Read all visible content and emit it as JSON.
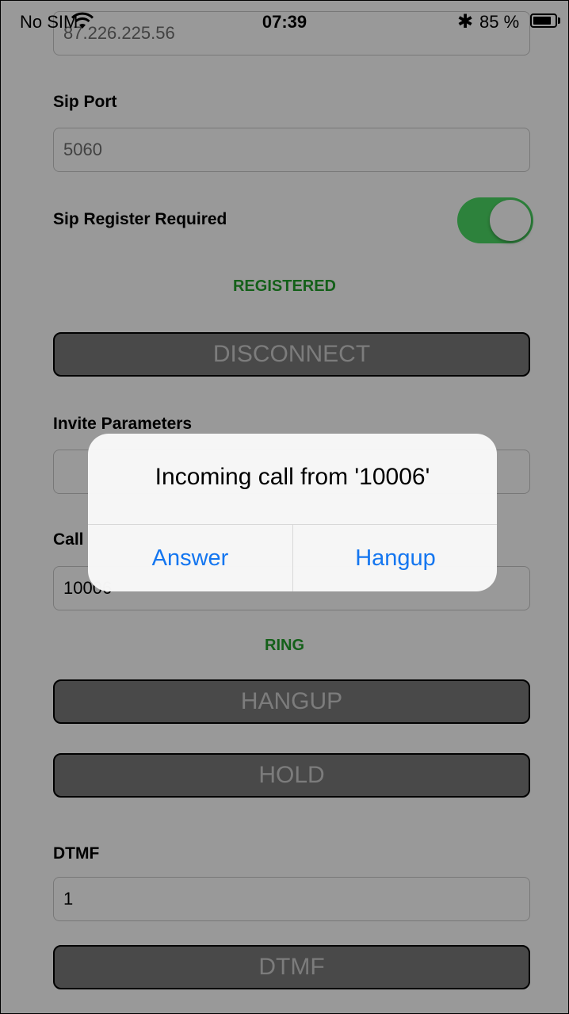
{
  "status_bar": {
    "carrier": "No SIM",
    "time": "07:39",
    "battery_percent": "85 %",
    "battery_level": 0.85,
    "icons": [
      "wifi-icon",
      "bluetooth-icon",
      "battery-icon"
    ]
  },
  "form": {
    "sip_server_value": "87.226.225.56",
    "sip_port_label": "Sip Port",
    "sip_port_value": "5060",
    "sip_register_label": "Sip Register Required",
    "sip_register_on": true,
    "registration_status": "REGISTERED",
    "disconnect_label": "DISCONNECT",
    "invite_params_label": "Invite Parameters",
    "invite_params_value": "",
    "call_label": "Call",
    "call_value": "10006",
    "call_status": "RING",
    "hangup_label": "HANGUP",
    "hold_label": "HOLD",
    "dtmf_label": "DTMF",
    "dtmf_value": "1",
    "dtmf_button_label": "DTMF"
  },
  "alert": {
    "title": "Incoming call from '10006'",
    "answer_label": "Answer",
    "hangup_label": "Hangup"
  },
  "colors": {
    "status_green": "#22a12a",
    "toggle_green": "#4cd964",
    "alert_action_blue": "#1476f0",
    "button_gray": "#7a7a7a"
  }
}
